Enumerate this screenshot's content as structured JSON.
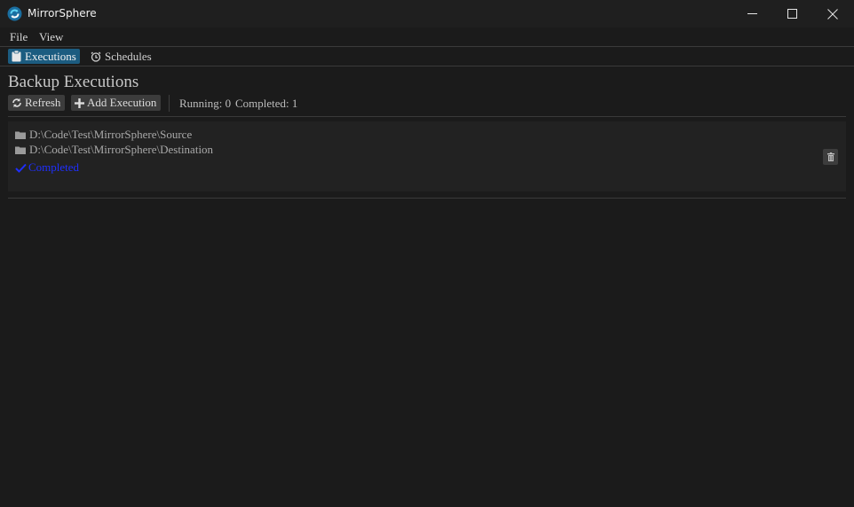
{
  "window": {
    "title": "MirrorSphere",
    "icon": "sync-circle-icon",
    "controls": [
      "minimize-icon",
      "maximize-icon",
      "close-icon"
    ]
  },
  "menu": {
    "items": [
      "File",
      "View"
    ]
  },
  "tabs": [
    {
      "label": "Executions",
      "icon": "clipboard-icon",
      "active": true
    },
    {
      "label": "Schedules",
      "icon": "alarm-clock-icon",
      "active": false
    }
  ],
  "page": {
    "title": "Backup Executions",
    "refresh_label": "Refresh",
    "add_label": "Add Execution",
    "running_text": "Running: 0",
    "completed_text": "Completed: 1"
  },
  "executions": [
    {
      "source": "D:\\Code\\Test\\MirrorSphere\\Source",
      "destination": "D:\\Code\\Test\\MirrorSphere\\Destination",
      "status": "Completed",
      "status_color": "#1f2fff"
    }
  ],
  "colors": {
    "accent": "#1c5c80",
    "background": "#1b1b1b",
    "card": "#222222"
  }
}
